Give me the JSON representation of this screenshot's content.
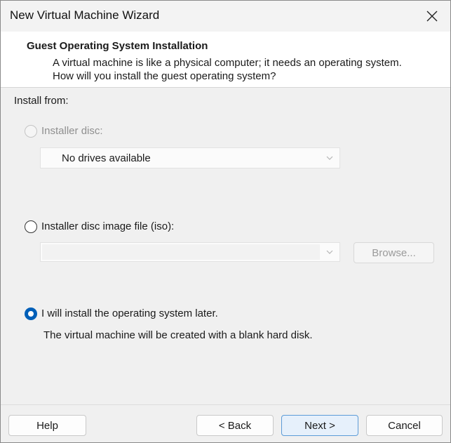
{
  "window": {
    "title": "New Virtual Machine Wizard"
  },
  "header": {
    "title": "Guest Operating System Installation",
    "description": "A virtual machine is like a physical computer; it needs an operating system. How will you install the guest operating system?"
  },
  "install_from": {
    "label": "Install from:",
    "installer_disc": {
      "label": "Installer disc:",
      "selected": false,
      "enabled": false,
      "drive_value": "No drives available"
    },
    "iso": {
      "label": "Installer disc image file (iso):",
      "selected": false,
      "path_value": "",
      "browse_label": "Browse..."
    },
    "later": {
      "label": "I will install the operating system later.",
      "selected": true,
      "note": "The virtual machine will be created with a blank hard disk."
    }
  },
  "footer": {
    "help": "Help",
    "back": "< Back",
    "next": "Next >",
    "cancel": "Cancel"
  },
  "colors": {
    "accent": "#005fb8",
    "disabled_text": "#8f8f8f"
  }
}
